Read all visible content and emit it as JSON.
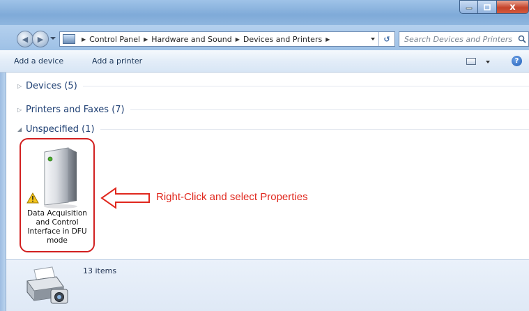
{
  "window": {
    "controls": {
      "minimize_icon": "minimize-icon",
      "maximize_icon": "maximize-icon",
      "close_label": "x"
    }
  },
  "address": {
    "breadcrumbs": [
      "Control Panel",
      "Hardware and Sound",
      "Devices and Printers"
    ],
    "trailing_arrow": "▶"
  },
  "search": {
    "placeholder": "Search Devices and Printers"
  },
  "commands": {
    "add_device": "Add a device",
    "add_printer": "Add a printer",
    "help": "?"
  },
  "groups": {
    "devices": "Devices (5)",
    "printers": "Printers and Faxes (7)",
    "unspecified": "Unspecified (1)"
  },
  "device": {
    "label_lines": [
      "Data Acquisition",
      "and Control",
      "Interface in DFU",
      "mode"
    ],
    "warning_icon": "warning-icon"
  },
  "annotation": {
    "text": "Right-Click and select Properties",
    "color": "#e0281e"
  },
  "details": {
    "count": "13 items"
  },
  "colors": {
    "highlight_border": "#d22020",
    "group_text": "#1e3f73"
  }
}
